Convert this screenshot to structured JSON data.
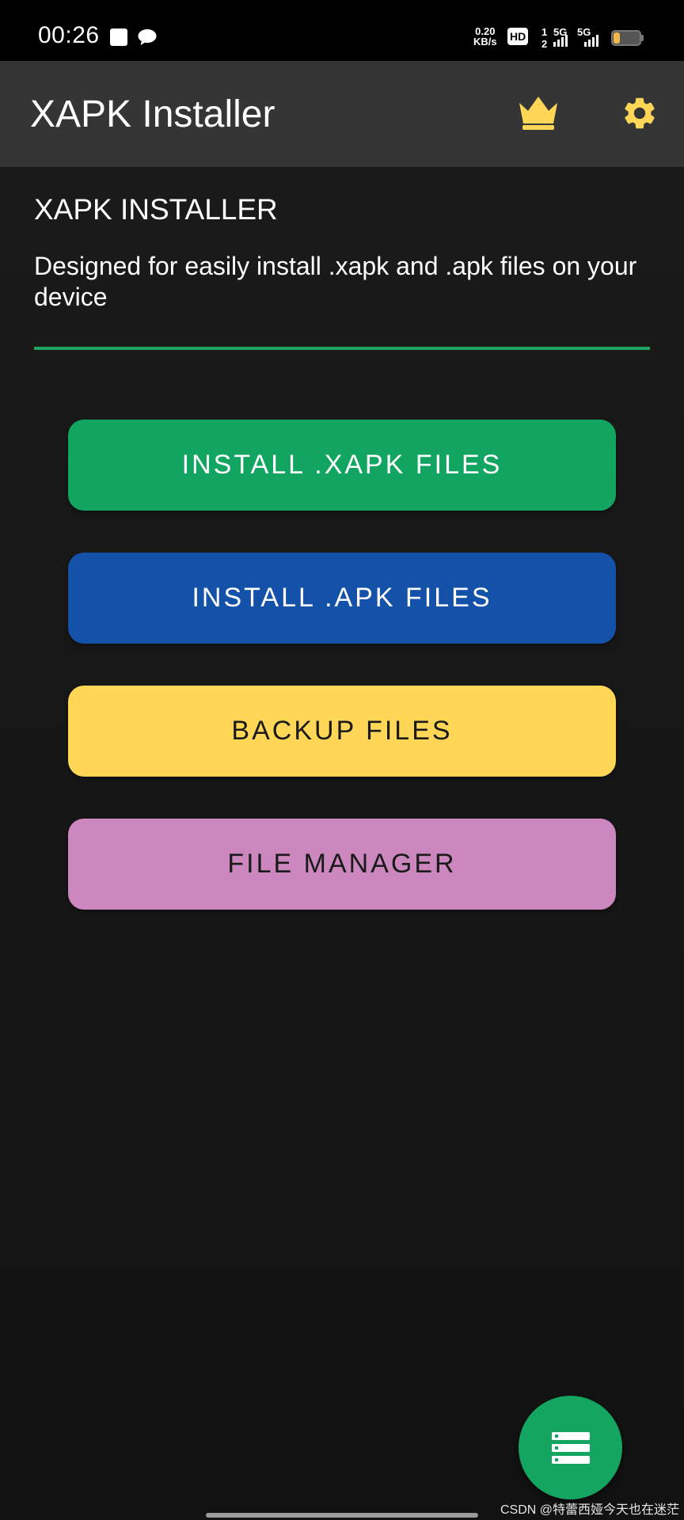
{
  "status_bar": {
    "time": "00:26",
    "net_speed_value": "0.20",
    "net_speed_unit": "KB/s",
    "hd_label": "HD",
    "sim1_label": "5G",
    "sim2_label": "5G",
    "battery_color": "#f2b94a"
  },
  "app_bar": {
    "title": "XAPK Installer",
    "crown_icon": "crown-icon",
    "settings_icon": "gear-icon",
    "accent_color": "#ffd655"
  },
  "intro": {
    "title": "XAPK INSTALLER",
    "description": "Designed for easily install .xapk and .apk files on your device",
    "divider_color": "#1fa464"
  },
  "actions": [
    {
      "label": "INSTALL .XAPK FILES",
      "color": "#12a561"
    },
    {
      "label": "INSTALL .APK FILES",
      "color": "#1352a8"
    },
    {
      "label": "BACKUP FILES",
      "color": "#ffd655"
    },
    {
      "label": "FILE MANAGER",
      "color": "#cc88be"
    }
  ],
  "fab": {
    "icon": "storage-list-icon",
    "color": "#14a561"
  },
  "watermark": "CSDN @特蕾西娅今天也在迷茫"
}
